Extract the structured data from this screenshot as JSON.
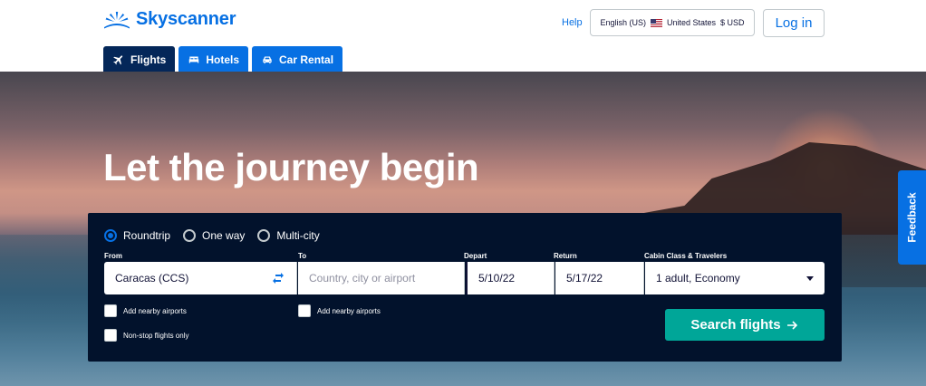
{
  "brand": {
    "name": "Skyscanner",
    "color": "#0770e3",
    "icon": "sunrise-logo-icon"
  },
  "header": {
    "help_label": "Help",
    "locale": {
      "language": "English (US)",
      "country": "United States",
      "currency": "$ USD"
    },
    "login_label": "Log in"
  },
  "tabs": [
    {
      "label": "Flights",
      "icon": "plane-icon",
      "active": true
    },
    {
      "label": "Hotels",
      "icon": "bed-icon",
      "active": false
    },
    {
      "label": "Car Rental",
      "icon": "car-icon",
      "active": false
    }
  ],
  "hero": {
    "title": "Let the journey begin"
  },
  "search": {
    "trip_types": [
      {
        "label": "Roundtrip",
        "checked": true
      },
      {
        "label": "One way",
        "checked": false
      },
      {
        "label": "Multi-city",
        "checked": false
      }
    ],
    "from": {
      "label": "From",
      "value": "Caracas (CCS)"
    },
    "to": {
      "label": "To",
      "value": "",
      "placeholder": "Country, city or airport"
    },
    "depart": {
      "label": "Depart",
      "value": "5/10/22"
    },
    "return": {
      "label": "Return",
      "value": "5/17/22"
    },
    "cabin": {
      "label": "Cabin Class & Travelers",
      "value": "1 adult, Economy"
    },
    "add_nearby_from_label": "Add nearby airports",
    "add_nearby_to_label": "Add nearby airports",
    "nonstop_label": "Non-stop flights only",
    "search_button_label": "Search flights",
    "search_button_color": "#00a698"
  },
  "feedback_label": "Feedback"
}
